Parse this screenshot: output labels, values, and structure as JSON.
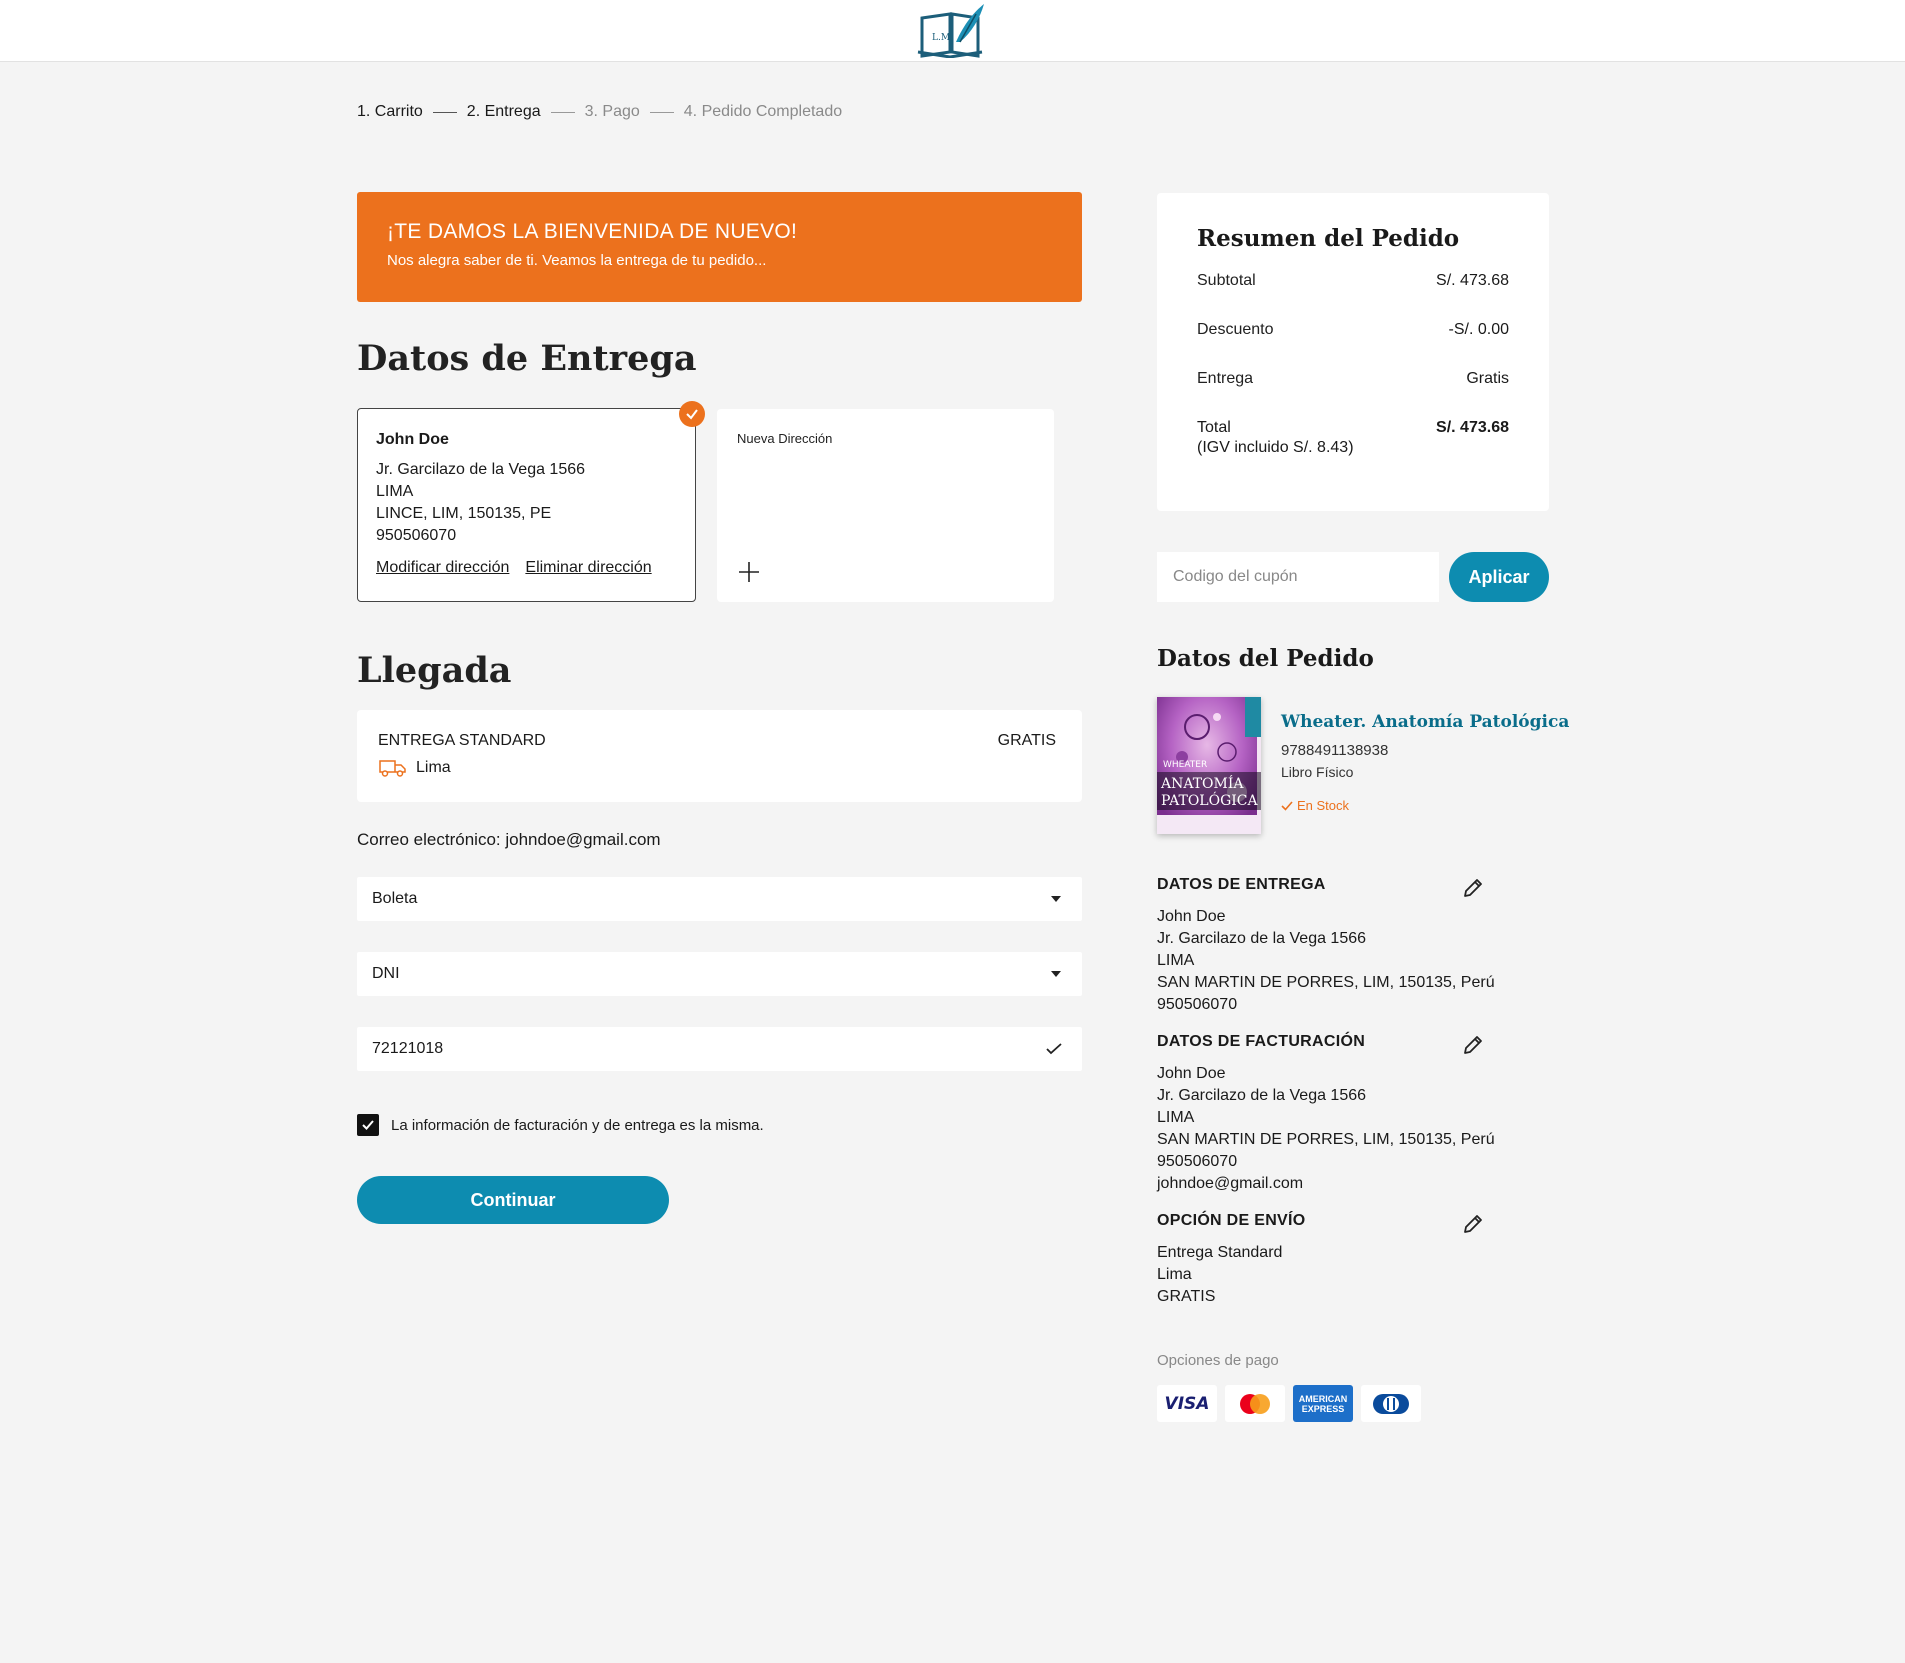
{
  "steps": [
    "1. Carrito",
    "2. Entrega",
    "3. Pago",
    "4. Pedido Completado"
  ],
  "welcome": {
    "title": "¡TE DAMOS LA BIENVENIDA DE NUEVO!",
    "subtitle": "Nos alegra saber de ti. Veamos la entrega de tu pedido..."
  },
  "delivery": {
    "heading": "Datos de Entrega",
    "address": {
      "name": "John Doe",
      "line1": "Jr. Garcilazo de la Vega 1566",
      "line2": "LIMA",
      "line3": "LINCE, LIM, 150135, PE",
      "phone": "950506070",
      "edit_link": "Modificar dirección",
      "delete_link": "Eliminar dirección"
    },
    "new_address_label": "Nueva Dirección"
  },
  "arrival": {
    "heading": "Llegada",
    "option_title": "ENTREGA STANDARD",
    "option_city": "Lima",
    "option_price": "GRATIS"
  },
  "email_line": "Correo electrónico: johndoe@gmail.com",
  "form": {
    "document_type": "Boleta",
    "id_type": "DNI",
    "id_number": "72121018",
    "same_info_label": "La información de facturación y de entrega es la misma.",
    "continue_label": "Continuar"
  },
  "summary": {
    "title": "Resumen del Pedido",
    "subtotal_label": "Subtotal",
    "subtotal_value": "S/. 473.68",
    "discount_label": "Descuento",
    "discount_value": "-S/. 0.00",
    "shipping_label": "Entrega",
    "shipping_value": "Gratis",
    "total_label": "Total",
    "total_value": "S/. 473.68",
    "tax_note": "(IGV incluido S/. 8.43)"
  },
  "coupon": {
    "placeholder": "Codigo del cupón",
    "apply_label": "Aplicar"
  },
  "order": {
    "heading": "Datos del Pedido",
    "book_title": "Wheater. Anatomía Patológica",
    "isbn": "9788491138938",
    "format": "Libro Físico",
    "stock": "En Stock",
    "cover_publisher": "WHEATER",
    "cover_title_1": "ANATOMÍA",
    "cover_title_2": "PATOLÓGICA"
  },
  "delivery_info": {
    "heading": "DATOS DE ENTREGA",
    "lines": [
      "John Doe",
      "Jr. Garcilazo de la Vega 1566",
      "LIMA",
      "SAN MARTIN DE PORRES, LIM, 150135, Perú",
      "950506070"
    ]
  },
  "billing_info": {
    "heading": "DATOS DE FACTURACIÓN",
    "lines": [
      "John Doe",
      "Jr. Garcilazo de la Vega 1566",
      "LIMA",
      "SAN MARTIN DE PORRES, LIM, 150135, Perú",
      "950506070",
      "johndoe@gmail.com"
    ]
  },
  "shipping_info": {
    "heading": "OPCIÓN DE ENVÍO",
    "lines": [
      "Entrega Standard",
      "Lima",
      "GRATIS"
    ]
  },
  "payment": {
    "label": "Opciones de pago",
    "visa": "VISA",
    "amex_1": "AMERICAN",
    "amex_2": "EXPRESS"
  },
  "colors": {
    "accent_orange": "#ec711d",
    "primary_blue": "#0d8cb0",
    "link_teal": "#0a6d8a"
  }
}
